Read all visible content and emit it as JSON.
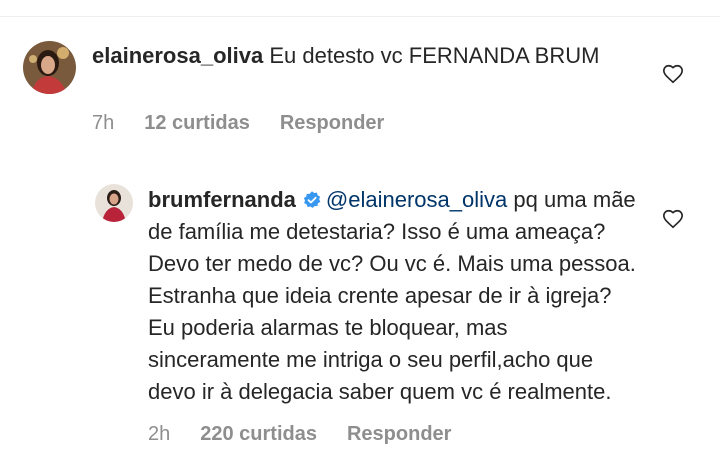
{
  "comment": {
    "username": "elainerosa_oliva",
    "text": "Eu detesto vc FERNANDA BRUM",
    "time": "7h",
    "likes": "12 curtidas",
    "reply_label": "Responder"
  },
  "reply": {
    "username": "brumfernanda",
    "mention": "@elainerosa_oliva",
    "text": "pq uma mãe de família me detestaria? Isso é uma ameaça? Devo ter medo de vc? Ou vc é. Mais uma pessoa. Estranha que ideia crente apesar de ir à igreja? Eu poderia alarmas te bloquear, mas sinceramente me intriga o seu perfil,acho que devo ir à delegacia saber quem vc é realmente.",
    "time": "2h",
    "likes": "220 curtidas",
    "reply_label": "Responder"
  },
  "colors": {
    "text": "#262626",
    "meta": "#8e8e8e",
    "mention": "#003569",
    "verified": "#3897f0"
  },
  "icons": [
    "heart-outline-icon",
    "verified-badge-icon"
  ]
}
